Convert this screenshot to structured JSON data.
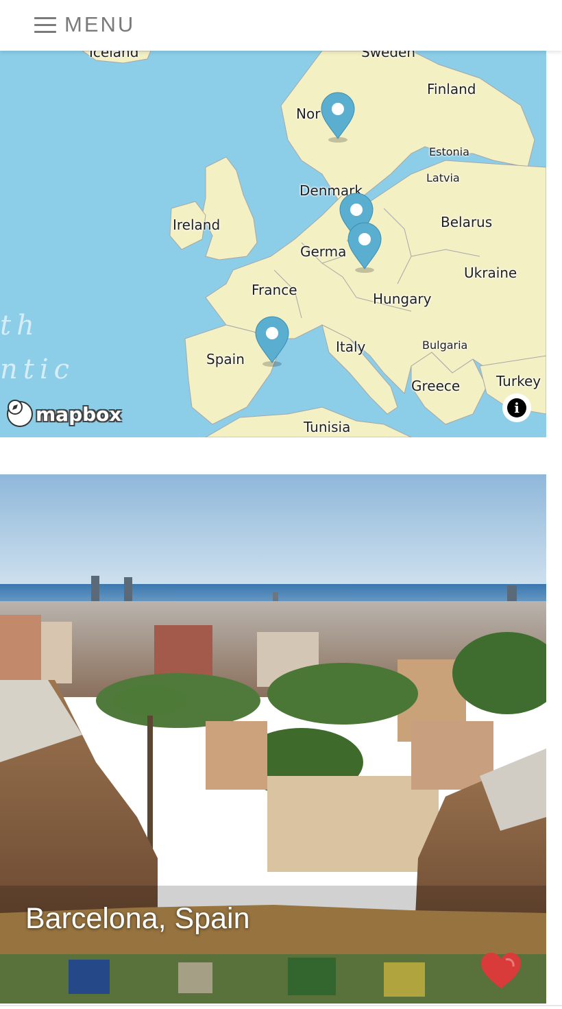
{
  "header": {
    "menu_label": "MENU"
  },
  "map": {
    "labels": {
      "iceland": "Iceland",
      "sweden": "Sweden",
      "finland": "Finland",
      "norway": "Nor",
      "estonia": "Estonia",
      "latvia": "Latvia",
      "denmark": "Denmark",
      "ireland": "Ireland",
      "belarus": "Belarus",
      "germany": "Germa",
      "ukraine": "Ukraine",
      "france": "France",
      "hungary": "Hungary",
      "italy": "Italy",
      "bulgaria": "Bulgaria",
      "spain": "Spain",
      "greece": "Greece",
      "turkey": "Turkey",
      "tunisia": "Tunisia",
      "ocean_1": "th",
      "ocean_2": "ntic"
    },
    "attribution": "mapbox",
    "info_icon": "i",
    "pin_color": "#5aaed0",
    "land_color": "#f3f0c3",
    "water_color": "#8ccde8"
  },
  "card": {
    "title": "Barcelona, Spain",
    "heart_color": "#d93a3a"
  }
}
